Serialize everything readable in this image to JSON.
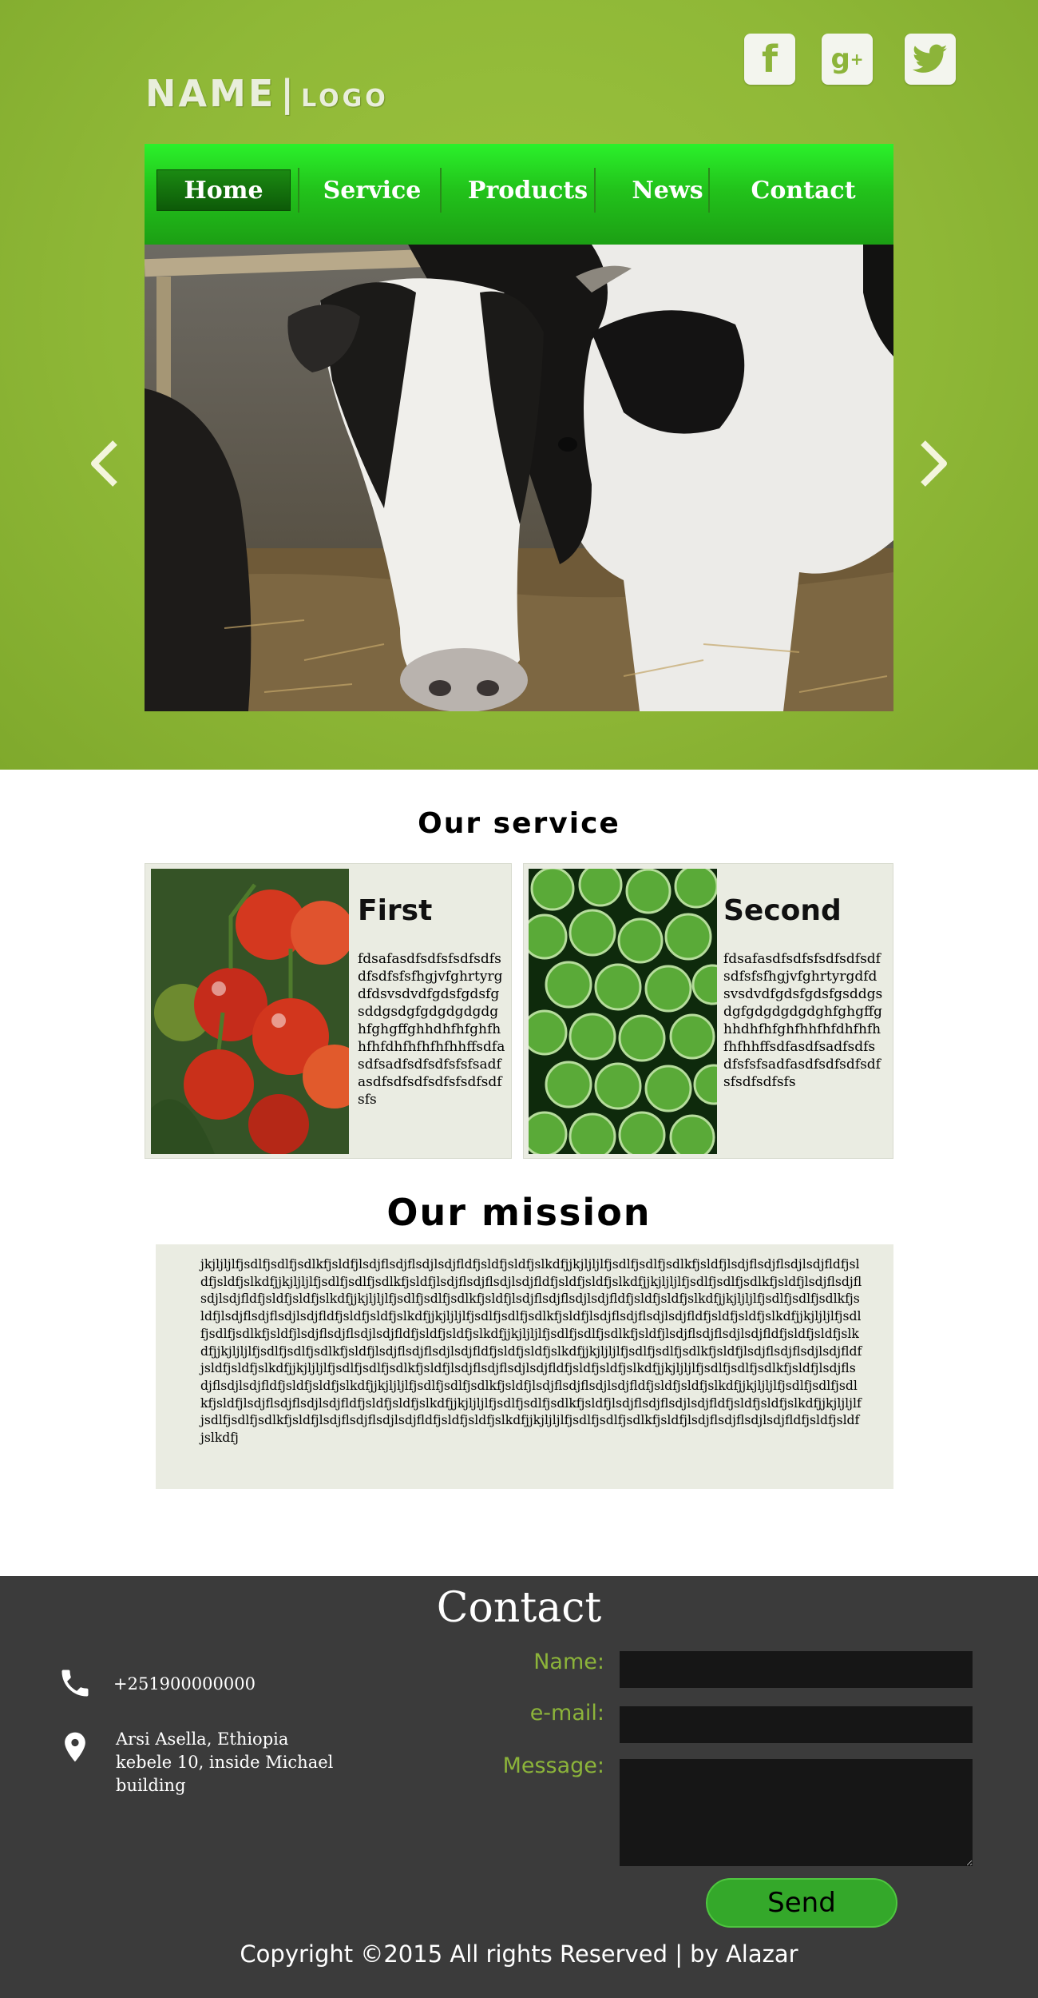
{
  "header": {
    "logo_name": "NAME",
    "logo_sep": "|",
    "logo_small": "LOGO",
    "social": [
      "facebook-icon",
      "google-plus-icon",
      "twitter-icon"
    ]
  },
  "nav": {
    "items": [
      "Home",
      "Service",
      "Products",
      "News",
      "Contact"
    ],
    "active": "Home"
  },
  "services": {
    "title": "Our service",
    "cards": [
      {
        "title": "First",
        "text": "fdsafasdfsdfsfsdfsdfsdfsdfsfsfhgjvfghrtyrgdfdsvsdvdfgdsfgdsfgsddgsdgfgdgdgdgdghfghgffghhdhfhfghfhhfhfdhfhfhfhfhhffsdfasdfsadfsdfsdfsfsfsadfasdfsdfsdfsdfsfsdfsdfsfs"
      },
      {
        "title": "Second",
        "text": "fdsafasdfsdfsfsdfsdfsdfsdfsfsfhgjvfghrtyrgdfdsvsdvdfgdsfgdsfgsddgsdgfgdgdgdgdghfghgffghhdhfhfghfhhfhfdhfhfhfhfhhffsdfasdfsadfsdfsdfsfsfsadfasdfsdfsdfsdfsfsdfsdfsfs"
      }
    ]
  },
  "mission": {
    "title": "Our mission",
    "text": "jkjljljlfjsdlfjsdlfjsdlkfjsldfjlsdjflsdjflsdjlsdjfldfjsldfjsldfjslkdfjjkjljljlfjsdlfjsdlfjsdlkfjsldfjlsdjflsdjflsdjlsdjfldfjsldfjsldfjslkdfjjkjljljlfjsdlfjsdlfjsdlkfjsldfjlsdjflsdjflsdjlsdjfldfjsldfjsldfjslkdfjjkjljljlfjsdlfjsdlfjsdlkfjsldfjlsdjflsdjflsdjlsdjfldfjsldfjsldfjslkdfjjkjljljlfjsdlfjsdlfjsdlkfjsldfjlsdjflsdjflsdjlsdjfldfjsldfjsldfjslkdfjjkjljljlfjsdlfjsdlfjsdlkfjsldfjlsdjflsdjflsdjlsdjfldfjsldfjsldfjslkdfjjkjljljlfjsdlfjsdlfjsdlkfjsldfjlsdjflsdjflsdjlsdjfldfjsldfjsldfjslkdfjjkjljljlfjsdlfjsdlfjsdlkfjsldfjlsdjflsdjflsdjlsdjfldfjsldfjsldfjslkdfjjkjljljlfjsdlfjsdlfjsdlkfjsldfjlsdjflsdjflsdjlsdjfldfjsldfjsldfjslkdfjjkjljljlfjsdlfjsdlfjsdlkfjsldfjlsdjflsdjflsdjlsdjfldfjsldfjsldfjslkdfjjkjljljlfjsdlfjsdlfjsdlkfjsldfjlsdjflsdjflsdjlsdjfldfjsldfjsldfjslkdfjjkjljljlfjsdlfjsdlfjsdlkfjsldfjlsdjflsdjflsdjlsdjfldfjsldfjsldfjslkdfjjkjljljlfjsdlfjsdlfjsdlkfjsldfjlsdjflsdjflsdjlsdjfldfjsldfjsldfjslkdfjjkjljljlfjsdlfjsdlfjsdlkfjsldfjlsdjflsdjflsdjlsdjfldfjsldfjsldfjslkdfjjkjljljlfjsdlfjsdlfjsdlkfjsldfjlsdjflsdjflsdjlsdjfldfjsldfjsldfjslkdfjjkjljljlfjsdlfjsdlfjsdlkfjsldfjlsdjflsdjflsdjlsdjfldfjsldfjsldfjslkdfjjkjljljlfjsdlfjsdlfjsdlkfjsldfjlsdjflsdjflsdjlsdjfldfjsldfjsldfjslkdfjjkjljljlfjsdlfjsdlfjsdlkfjsldfjlsdjflsdjflsdjlsdjfldfjsldfjsldfjslkdfj"
  },
  "contact": {
    "title": "Contact",
    "phone": "+251900000000",
    "address": "Arsi Asella, Ethiopia kebele 10, inside Michael building",
    "form": {
      "name_label": "Name:",
      "email_label": "e-mail:",
      "message_label": "Message:",
      "send_label": "Send"
    },
    "copyright": "Copyright ©2015 All rights Reserved | by Alazar"
  },
  "colors": {
    "hero_green": "#8fb837",
    "nav_green": "#22c31b",
    "label_green": "#8cb43a",
    "footer_bg": "#3b3b3b",
    "card_bg": "#eaece2"
  }
}
